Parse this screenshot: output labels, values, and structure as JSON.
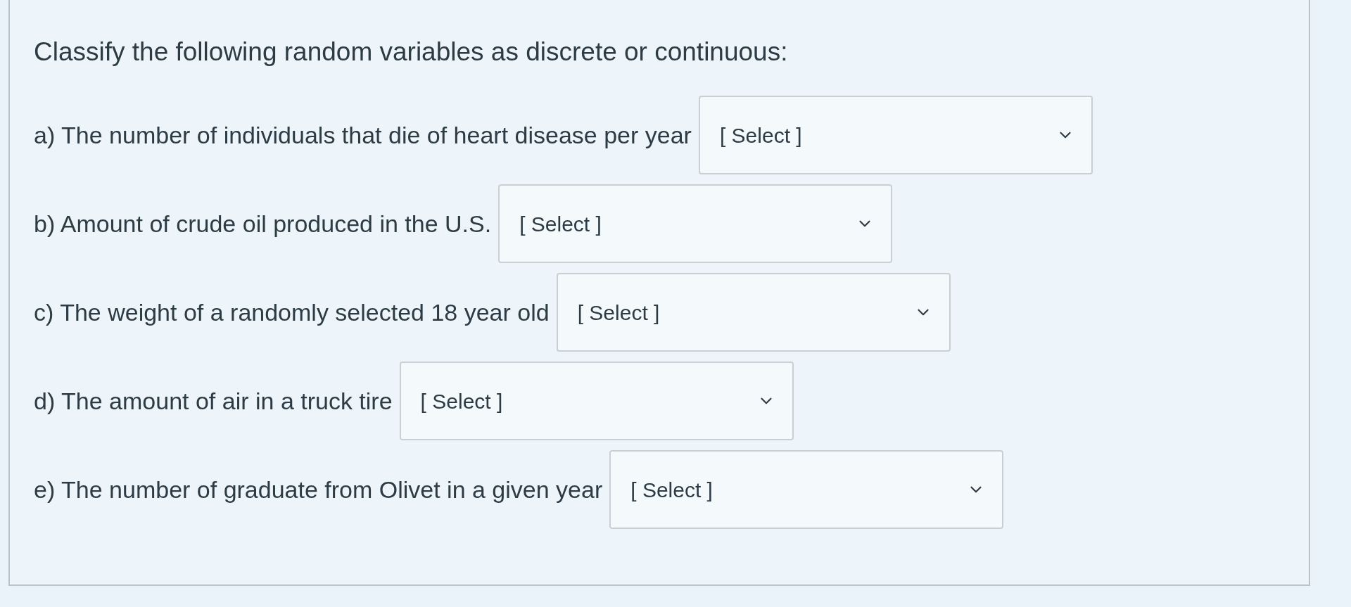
{
  "question": {
    "prompt": "Classify the following random variables as discrete or continuous:"
  },
  "items": [
    {
      "label": "a) The number of individuals that die of heart disease per year",
      "answer": "[ Select ]"
    },
    {
      "label": "b) Amount of crude oil produced in the U.S.",
      "answer": "[ Select ]"
    },
    {
      "label": "c) The weight of a randomly selected 18 year old",
      "answer": "[ Select ]"
    },
    {
      "label": "d) The amount of air in a truck tire",
      "answer": "[ Select ]"
    },
    {
      "label": "e) The number of graduate from Olivet in a given year",
      "answer": "[ Select ]"
    }
  ]
}
